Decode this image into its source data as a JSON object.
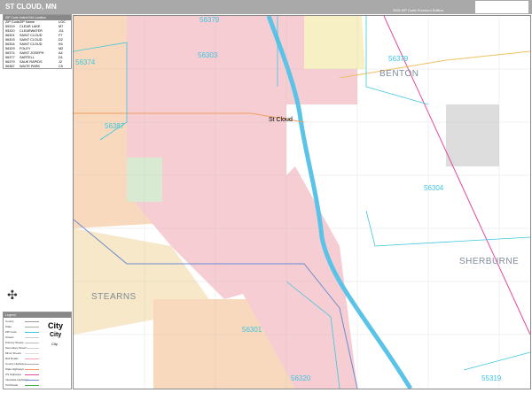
{
  "header": {
    "title": "ST CLOUD, MN",
    "edition": "2026 ZIP Code Premium Edition"
  },
  "zip_index": {
    "title": "ZIP Code Index/Grid Location",
    "columns": [
      "ZIP Code",
      "ZIP Name",
      "LOC"
    ],
    "rows": [
      [
        "55319",
        "CLEAR LAKE",
        "M7"
      ],
      [
        "55320",
        "CLEARWATER",
        "J11"
      ],
      [
        "56301",
        "SAINT CLOUD",
        "F7"
      ],
      [
        "56303",
        "SAINT CLOUD",
        "D2"
      ],
      [
        "56304",
        "SAINT CLOUD",
        "K6"
      ],
      [
        "56329",
        "FOLEY",
        "M2"
      ],
      [
        "56374",
        "SAINT JOSEPH",
        "A4"
      ],
      [
        "56377",
        "SARTELL",
        "D1"
      ],
      [
        "56379",
        "SAUK RAPIDS",
        "J2"
      ],
      [
        "56387",
        "WAITE PARK",
        "C5"
      ]
    ]
  },
  "legend": {
    "title": "Legend",
    "items": [
      "County",
      "State",
      "ZIP Code",
      "Streets",
      "Primary Streets",
      "Secondary Streets",
      "Minor Streets",
      "Rail Roads",
      "County Highways",
      "State Highways",
      "US Highways",
      "Interstate Highways",
      "Toll Roads"
    ],
    "city_label": "City"
  },
  "map": {
    "labels": {
      "z56379": "56379",
      "z56303": "56303",
      "z56374": "56374",
      "z56387": "56387",
      "z56304": "56304",
      "z56301": "56301",
      "z56320": "56320",
      "z55319": "55319",
      "benton": "BENTON",
      "sherburne": "SHERBURNE",
      "stearns": "STEARNS",
      "stcloud": "St Cloud"
    },
    "colors": {
      "zip_boundary": "#3cc6e0",
      "river": "#5bc3e8",
      "pink": "#f6cdd2",
      "peach": "#f8d9bd",
      "yellow": "#f7f0c4"
    }
  }
}
